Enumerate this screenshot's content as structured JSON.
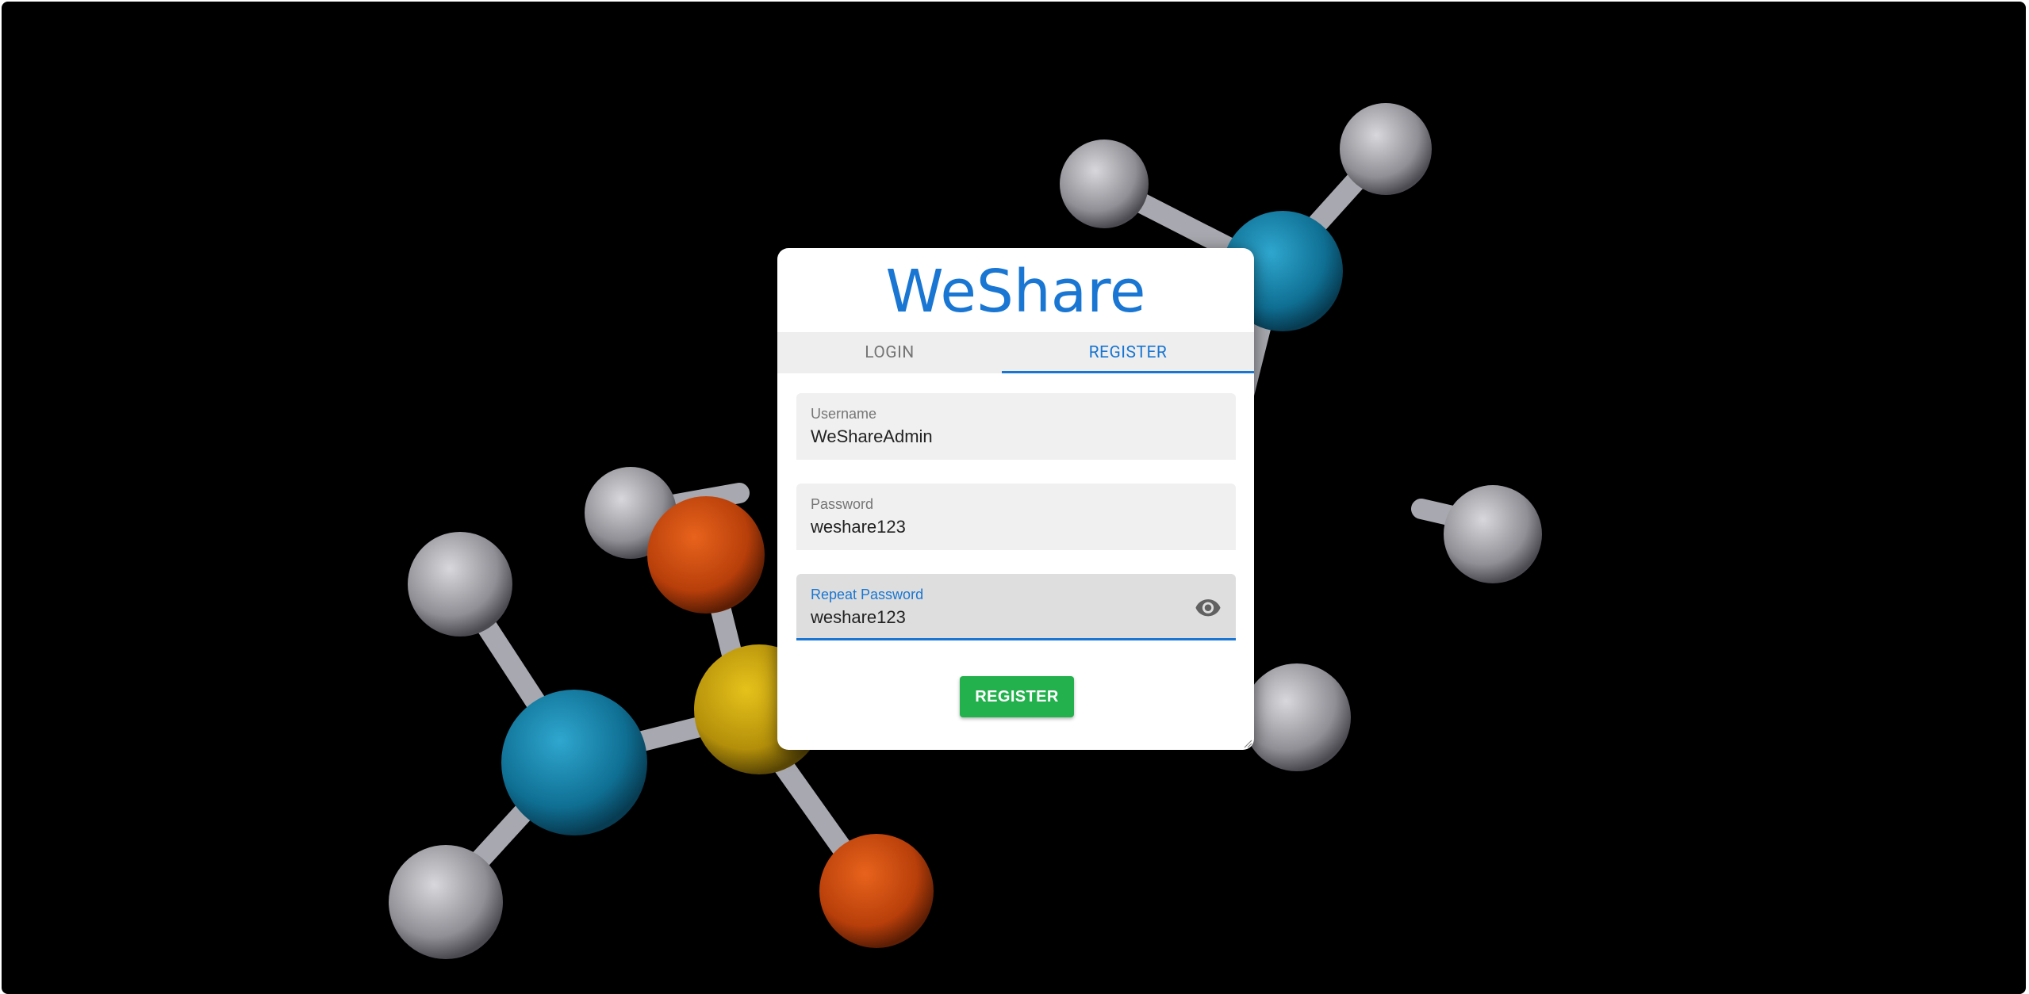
{
  "app": {
    "title": "WeShare"
  },
  "tabs": [
    {
      "label": "LOGIN",
      "active": false
    },
    {
      "label": "REGISTER",
      "active": true
    }
  ],
  "form": {
    "username": {
      "label": "Username",
      "value": "WeShareAdmin"
    },
    "password": {
      "label": "Password",
      "value": "weshare123"
    },
    "repeat_password": {
      "label": "Repeat Password",
      "value": "weshare123",
      "focused": true
    },
    "submit_label": "REGISTER"
  },
  "colors": {
    "primary": "#1976d2",
    "submit": "#22b14c",
    "background": "#000000"
  },
  "icons": {
    "toggle_visibility": "eye-icon"
  }
}
